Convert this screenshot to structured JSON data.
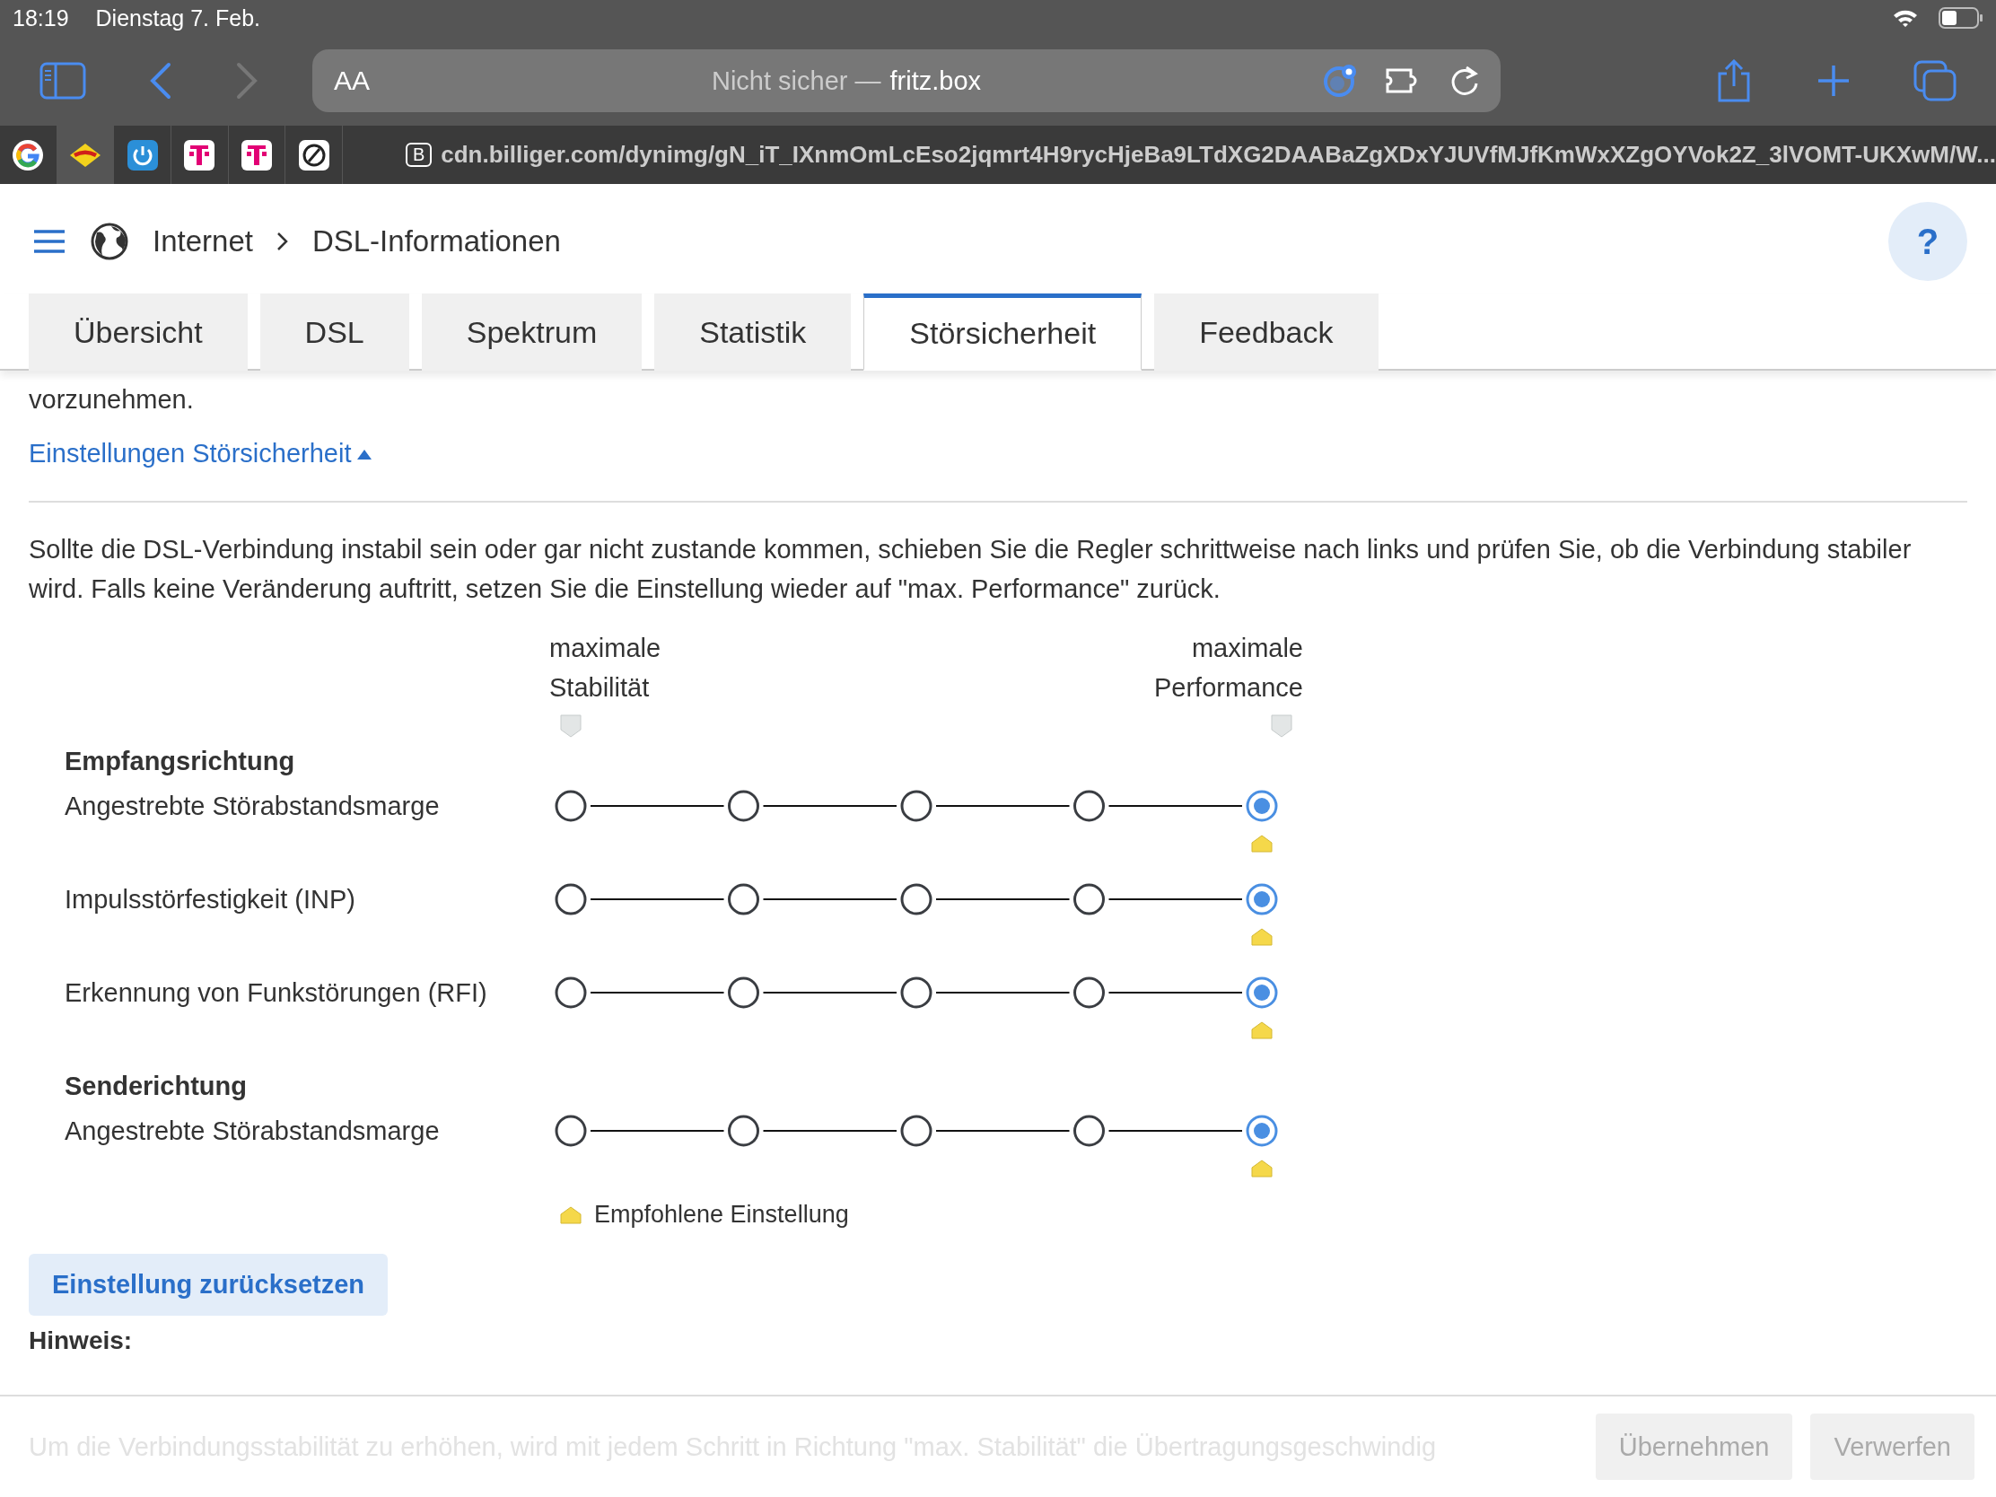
{
  "status_bar": {
    "time": "18:19",
    "date": "Dienstag 7. Feb."
  },
  "address_bar": {
    "text_size": "AA",
    "security": "Nicht sicher —",
    "host": "fritz.box"
  },
  "favorites": [
    {
      "kind": "google",
      "selected": false
    },
    {
      "kind": "fritz",
      "selected": true
    },
    {
      "kind": "power",
      "selected": false
    },
    {
      "kind": "telekom",
      "selected": false
    },
    {
      "kind": "telekom",
      "selected": false
    },
    {
      "kind": "camera",
      "selected": false
    }
  ],
  "open_tab": {
    "badge": "B",
    "url": "cdn.billiger.com/dynimg/gN_iT_IXnmOmLcEso2jqmrt4H9rycHjeBa9LTdXG2DAABaZgXDxYJUVfMJfKmWxXZgOYVok2Z_3lVOMT-UKXwM/W..."
  },
  "breadcrumb": [
    "Internet",
    "DSL-Informationen"
  ],
  "help": "?",
  "tabs": [
    {
      "label": "Übersicht",
      "selected": false
    },
    {
      "label": "DSL",
      "selected": false
    },
    {
      "label": "Spektrum",
      "selected": false
    },
    {
      "label": "Statistik",
      "selected": false
    },
    {
      "label": "Störsicherheit",
      "selected": true
    },
    {
      "label": "Feedback",
      "selected": false
    }
  ],
  "intro_tail": "vorzunehmen.",
  "settings_link": {
    "label": "Einstellungen Störsicherheit",
    "expanded": true
  },
  "description": "Sollte die DSL-Verbindung instabil sein oder gar nicht zustande kommen, schieben Sie die Regler schrittweise nach links und prüfen Sie, ob die Verbindung stabiler wird. Falls keine Veränderung auftritt, setzen Sie die Einstellung wieder auf \"max. Performance\" zurück.",
  "scale": {
    "left": [
      "maximale",
      "Stabilität"
    ],
    "right": [
      "maximale",
      "Performance"
    ]
  },
  "sections": [
    {
      "title": "Empfangsrichtung",
      "rows": [
        {
          "label": "Angestrebte Störabstandsmarge",
          "recommended": true,
          "options": [
            {
              "selected": false
            },
            {
              "selected": false
            },
            {
              "selected": false
            },
            {
              "selected": false
            },
            {
              "selected": true
            }
          ]
        },
        {
          "label": "Impulsstörfestigkeit (INP)",
          "recommended": true,
          "options": [
            {
              "selected": false
            },
            {
              "selected": false
            },
            {
              "selected": false
            },
            {
              "selected": false
            },
            {
              "selected": true
            }
          ]
        },
        {
          "label": "Erkennung von Funkstörungen (RFI)",
          "recommended": true,
          "options": [
            {
              "selected": false
            },
            {
              "selected": false
            },
            {
              "selected": false
            },
            {
              "selected": false
            },
            {
              "selected": true
            }
          ]
        }
      ]
    },
    {
      "title": "Senderichtung",
      "rows": [
        {
          "label": "Angestrebte Störabstandsmarge",
          "recommended": true,
          "options": [
            {
              "selected": false
            },
            {
              "selected": false
            },
            {
              "selected": false
            },
            {
              "selected": false
            },
            {
              "selected": true
            }
          ]
        }
      ]
    }
  ],
  "legend": "Empfohlene Einstellung",
  "reset_button": "Einstellung zurücksetzen",
  "note_title": "Hinweis:",
  "note_text": "Um die Verbindungsstabilität zu erhöhen, wird mit jedem Schritt in Richtung \"max. Stabilität\" die Übertragungsgeschwindig",
  "footer_buttons": [
    {
      "label": "Übernehmen",
      "disabled": true
    },
    {
      "label": "Verwerfen",
      "disabled": true
    }
  ]
}
